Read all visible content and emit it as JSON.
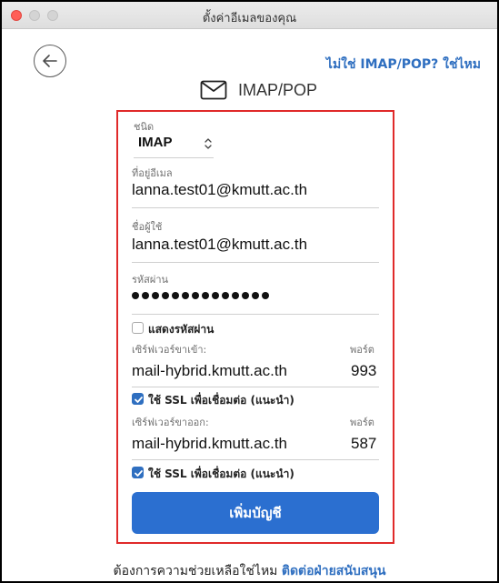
{
  "window": {
    "title": "ตั้งค่าอีเมลของคุณ"
  },
  "header": {
    "switch_link": "ไม่ใช่ IMAP/POP? ใช่ไหม",
    "account_type_label": "IMAP/POP"
  },
  "form": {
    "type": {
      "label": "ชนิด",
      "value": "IMAP"
    },
    "email": {
      "label": "ที่อยู่อีเมล",
      "value": "lanna.test01@kmutt.ac.th"
    },
    "username": {
      "label": "ชื่อผู้ใช้",
      "value": "lanna.test01@kmutt.ac.th"
    },
    "password": {
      "label": "รหัสผ่าน",
      "masked_length": 14
    },
    "show_password": {
      "label": "แสดงรหัสผ่าน",
      "checked": false
    },
    "incoming": {
      "server_label": "เซิร์ฟเวอร์ขาเข้า:",
      "port_label": "พอร์ต",
      "server": "mail-hybrid.kmutt.ac.th",
      "port": "993",
      "ssl_label": "ใช้ SSL เพื่อเชื่อมต่อ (แนะนำ)",
      "ssl_checked": true
    },
    "outgoing": {
      "server_label": "เซิร์ฟเวอร์ขาออก:",
      "port_label": "พอร์ต",
      "server": "mail-hybrid.kmutt.ac.th",
      "port": "587",
      "ssl_label": "ใช้ SSL เพื่อเชื่อมต่อ (แนะนำ)",
      "ssl_checked": true
    },
    "submit_label": "เพิ่มบัญชี"
  },
  "footer": {
    "help_text": "ต้องการความช่วยเหลือใช่ไหม",
    "help_link": "ติดต่อฝ่ายสนับสนุน"
  },
  "colors": {
    "accent": "#2b6fd0",
    "highlight": "#e02a2a"
  },
  "icons": [
    "back-arrow-icon",
    "mail-envelope-icon",
    "select-arrows-icon",
    "checkmark-icon"
  ]
}
